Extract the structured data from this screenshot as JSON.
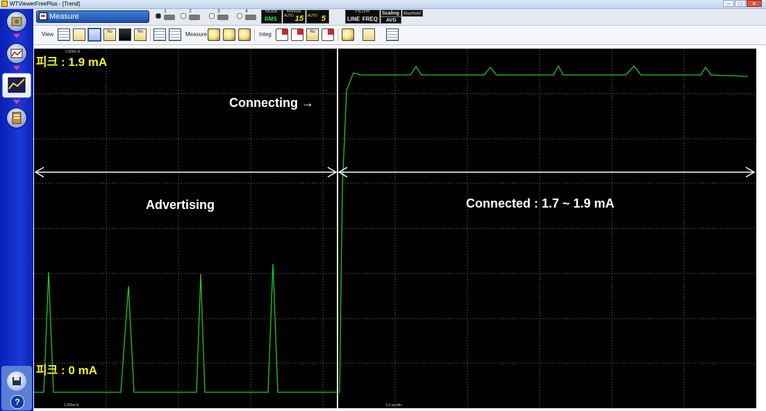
{
  "window": {
    "title": "WTViewerFreePlus - [Trend]",
    "buttons": {
      "minimize": "–",
      "maximize": "□",
      "close": "✕"
    }
  },
  "sidebar": {
    "nav_items": [
      {
        "icon": "instrument-settings-icon"
      },
      {
        "icon": "numeric-view-icon"
      },
      {
        "icon": "trend-view-icon",
        "active": true
      },
      {
        "icon": "data-file-icon"
      }
    ],
    "save_icon": "floppy-disk-icon",
    "help_label": "?"
  },
  "toolbar_top": {
    "measure_button_label": "Measure",
    "elements": [
      "1",
      "2",
      "3",
      "4"
    ],
    "selected_element": "1",
    "mode": {
      "caption": "MODE",
      "value": "RMS"
    },
    "range_v": {
      "caption": "RANGE",
      "auto": "AUTO",
      "value": "15"
    },
    "range_a": {
      "auto": "AUTO",
      "value": "5"
    },
    "filter": {
      "caption": "FILTER",
      "line": "LINE",
      "freq": "FREQ"
    },
    "scaling": "Scaling",
    "maxhold": "MaxHold",
    "avg": "AVG"
  },
  "toolbar_view": {
    "view_label": "View",
    "measure_label": "Measure",
    "integ_label": "Integ",
    "icon_texts": [
      "No",
      "No",
      "No"
    ]
  },
  "plot": {
    "background": "#000000",
    "trace_color": "#22c72a",
    "grid_color": "#7a7a7a",
    "divider_color": "#ffffff",
    "x_scale_label": "1.0 sec/div",
    "y_scale_label": "1.000m A",
    "top_tick_label": "2.000m A"
  },
  "annotations": {
    "peak_top": "피크 : 1.9 mA",
    "peak_bottom": "피크 : 0 mA",
    "connecting": "Connecting →",
    "advertising": "Advertising",
    "connected": "Connected : 1.7 ~ 1.9 mA"
  },
  "colors": {
    "sidebar": "#1a3ad6",
    "annotation_peak": "#f3f31a",
    "annotation_text": "#ffffff",
    "measure_button": "#2a5cc0"
  }
}
